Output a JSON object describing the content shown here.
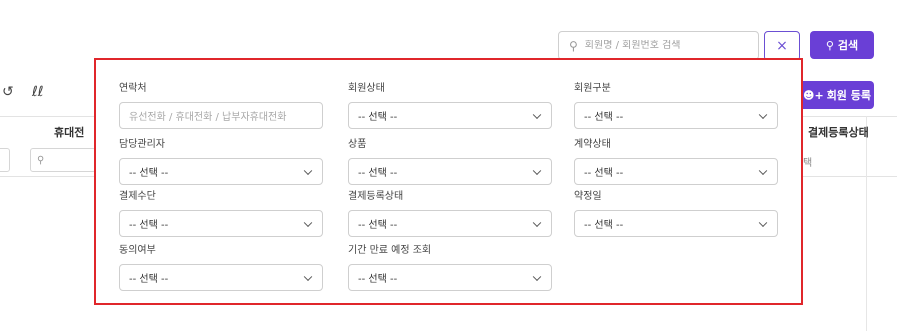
{
  "header": {
    "search_placeholder": "회원명 / 회원번호 검색",
    "clear_label": "×",
    "search_label": "검색",
    "register_label": "회원 등록"
  },
  "table": {
    "columns": [
      "휴대전",
      "결제등록상태"
    ],
    "filter_partial": "택"
  },
  "filter_panel": {
    "fields": [
      {
        "label": "연락처",
        "type": "text",
        "placeholder": "유선전화 / 휴대전화 / 납부자휴대전화"
      },
      {
        "label": "회원상태",
        "type": "select",
        "value": "-- 선택 --"
      },
      {
        "label": "회원구분",
        "type": "select",
        "value": "-- 선택 --"
      },
      {
        "label": "담당관리자",
        "type": "select",
        "value": "-- 선택 --"
      },
      {
        "label": "상품",
        "type": "select",
        "value": "-- 선택 --"
      },
      {
        "label": "계약상태",
        "type": "select",
        "value": "-- 선택 --"
      },
      {
        "label": "결제수단",
        "type": "select",
        "value": "-- 선택 --"
      },
      {
        "label": "결제등록상태",
        "type": "select",
        "value": "-- 선택 --"
      },
      {
        "label": "약정일",
        "type": "select",
        "value": "-- 선택 --"
      },
      {
        "label": "동의여부",
        "type": "select",
        "value": "-- 선택 --"
      },
      {
        "label": "기간 만료 예정 조회",
        "type": "select",
        "value": "-- 선택 --"
      }
    ]
  },
  "colors": {
    "accent": "#6a3fd6",
    "panel_border": "#e0262b"
  }
}
